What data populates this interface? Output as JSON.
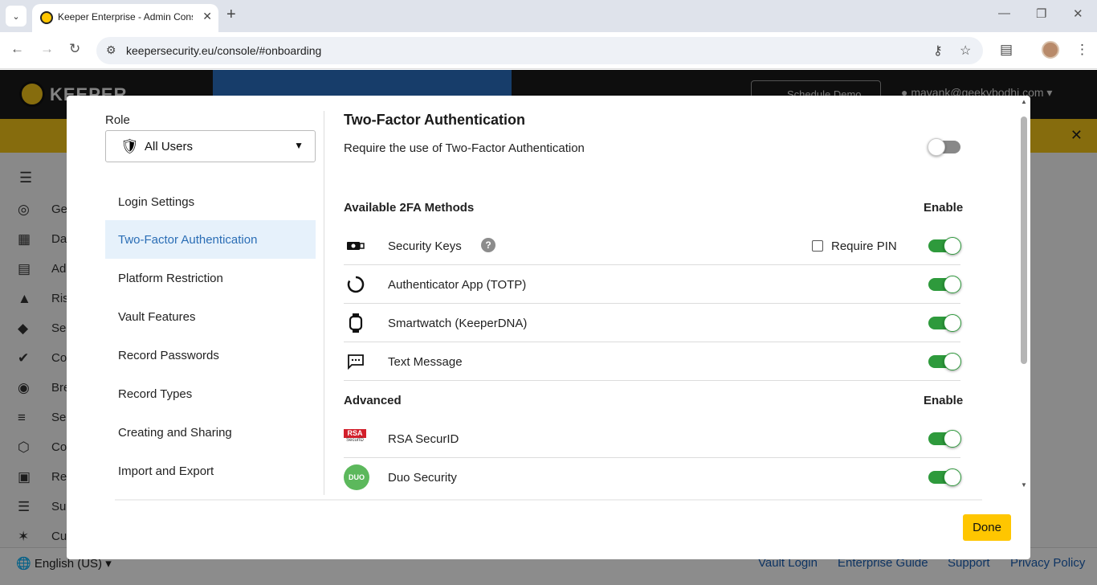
{
  "browser": {
    "tab_title": "Keeper Enterprise - Admin Console",
    "url": "keepersecurity.eu/console/#onboarding"
  },
  "app": {
    "logo_text": "KEEPER",
    "schedule_demo": "Schedule Demo",
    "account": "mavank@geekybodhi.com",
    "sidebar": [
      {
        "icon": "globe-icon",
        "label": "Ge"
      },
      {
        "icon": "dashboard-icon",
        "label": "Da"
      },
      {
        "icon": "admin-icon",
        "label": "Ad"
      },
      {
        "icon": "bell-icon",
        "label": "Ris"
      },
      {
        "icon": "shield-icon",
        "label": "Se"
      },
      {
        "icon": "compliance-icon",
        "label": "Co"
      },
      {
        "icon": "breachwatch-icon",
        "label": "Bre"
      },
      {
        "icon": "layers-icon",
        "label": "Se"
      },
      {
        "icon": "hexagon-icon",
        "label": "Co"
      },
      {
        "icon": "reports-icon",
        "label": "Re"
      },
      {
        "icon": "cart-icon",
        "label": "Su"
      },
      {
        "icon": "wand-icon",
        "label": "Cu"
      }
    ],
    "footer": {
      "language": "English (US)",
      "links": [
        "Vault Login",
        "Enterprise Guide",
        "Support",
        "Privacy Policy"
      ]
    }
  },
  "modal": {
    "role_label": "Role",
    "role_value": "All Users",
    "menu": [
      {
        "label": "Login Settings",
        "active": false
      },
      {
        "label": "Two-Factor Authentication",
        "active": true
      },
      {
        "label": "Platform Restriction",
        "active": false
      },
      {
        "label": "Vault Features",
        "active": false
      },
      {
        "label": "Record Passwords",
        "active": false
      },
      {
        "label": "Record Types",
        "active": false
      },
      {
        "label": "Creating and Sharing",
        "active": false
      },
      {
        "label": "Import and Export",
        "active": false
      }
    ],
    "section_title": "Two-Factor Authentication",
    "require_text": "Require the use of Two-Factor Authentication",
    "require_enabled": false,
    "available_title": "Available 2FA Methods",
    "enable_label": "Enable",
    "methods": [
      {
        "icon": "security-key-icon",
        "label": "Security Keys",
        "enabled": true,
        "help": "?",
        "pin_label": "Require PIN",
        "pin_checked": false
      },
      {
        "icon": "authenticator-icon",
        "label": "Authenticator App (TOTP)",
        "enabled": true
      },
      {
        "icon": "smartwatch-icon",
        "label": "Smartwatch (KeeperDNA)",
        "enabled": true
      },
      {
        "icon": "sms-icon",
        "label": "Text Message",
        "enabled": true
      }
    ],
    "advanced_title": "Advanced",
    "advanced": [
      {
        "icon": "rsa-logo",
        "label": "RSA SecurID",
        "logo_text": "RSA",
        "logo_sub": "SecurID",
        "enabled": true
      },
      {
        "icon": "duo-logo",
        "label": "Duo Security",
        "logo_text": "DUO",
        "enabled": true
      }
    ],
    "done_label": "Done"
  }
}
